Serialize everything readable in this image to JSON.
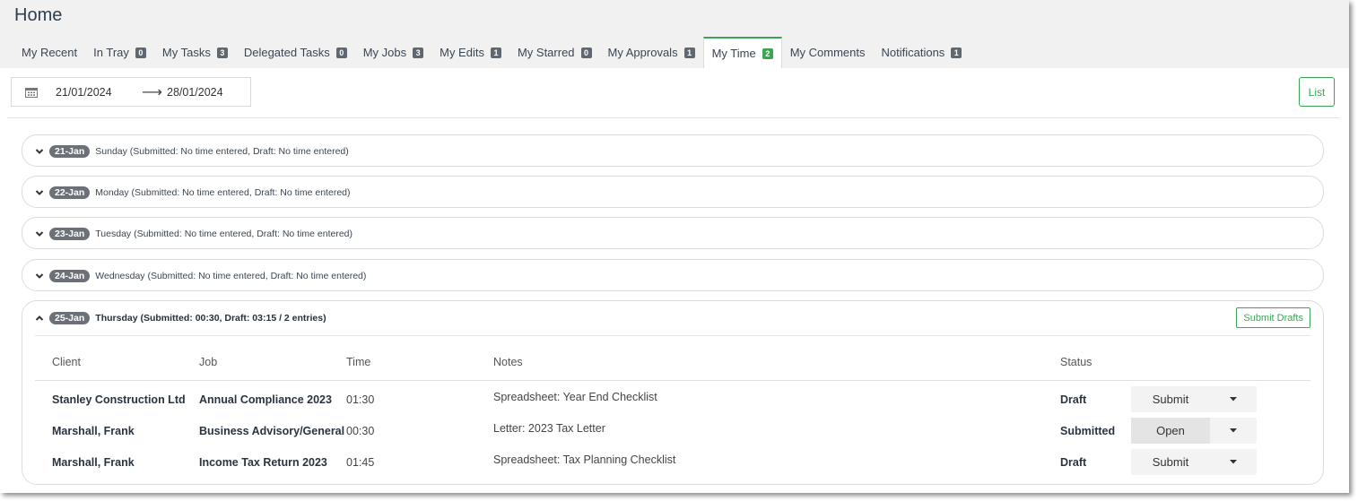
{
  "page": {
    "title": "Home"
  },
  "tabs": [
    {
      "label": "My Recent",
      "badge": null
    },
    {
      "label": "In Tray",
      "badge": "0"
    },
    {
      "label": "My Tasks",
      "badge": "3"
    },
    {
      "label": "Delegated Tasks",
      "badge": "0"
    },
    {
      "label": "My Jobs",
      "badge": "3"
    },
    {
      "label": "My Edits",
      "badge": "1"
    },
    {
      "label": "My Starred",
      "badge": "0"
    },
    {
      "label": "My Approvals",
      "badge": "1"
    },
    {
      "label": "My Time",
      "badge": "2",
      "active": true
    },
    {
      "label": "My Comments",
      "badge": null
    },
    {
      "label": "Notifications",
      "badge": "1"
    }
  ],
  "date_range": {
    "start": "21/01/2024",
    "arrow": "⟶",
    "end": "28/01/2024",
    "icon": "calendar-icon"
  },
  "view_toggle": {
    "label": "List"
  },
  "days": [
    {
      "date": "21-Jan",
      "summary": "Sunday (Submitted: No time entered, Draft: No time entered)",
      "expanded": false
    },
    {
      "date": "22-Jan",
      "summary": "Monday (Submitted: No time entered, Draft: No time entered)",
      "expanded": false
    },
    {
      "date": "23-Jan",
      "summary": "Tuesday (Submitted: No time entered, Draft: No time entered)",
      "expanded": false
    },
    {
      "date": "24-Jan",
      "summary": "Wednesday (Submitted: No time entered, Draft: No time entered)",
      "expanded": false
    },
    {
      "date": "25-Jan",
      "summary": "Thursday (Submitted: 00:30, Draft: 03:15 / 2 entries)",
      "expanded": true
    }
  ],
  "expanded_day": {
    "submit_drafts_label": "Submit Drafts",
    "columns": {
      "client": "Client",
      "job": "Job",
      "time": "Time",
      "notes": "Notes",
      "status": "Status"
    },
    "rows": [
      {
        "client": "Stanley Construction Ltd",
        "job": "Annual Compliance 2023",
        "time": "01:30",
        "notes": "Spreadsheet: Year End Checklist",
        "status": "Draft",
        "action": "Submit"
      },
      {
        "client": "Marshall, Frank",
        "job": "Business Advisory/General",
        "time": "00:30",
        "notes": "Letter: 2023 Tax Letter",
        "status": "Submitted",
        "action": "Open"
      },
      {
        "client": "Marshall, Frank",
        "job": "Income Tax Return 2023",
        "time": "01:45",
        "notes": "Spreadsheet: Tax Planning Checklist",
        "status": "Draft",
        "action": "Submit"
      }
    ]
  },
  "colors": {
    "accent": "#3aa655",
    "badge": "#5f6770",
    "pill": "#6c7178"
  }
}
